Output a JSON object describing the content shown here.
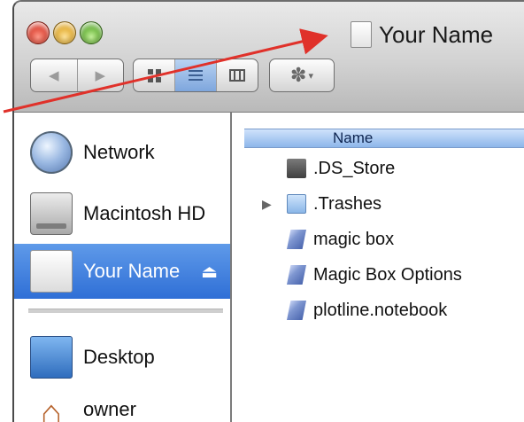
{
  "window": {
    "title": "Your Name"
  },
  "toolbar": {
    "back_glyph": "◀",
    "forward_glyph": "▶",
    "action_glyph": "✽",
    "action_caret": "▾"
  },
  "sidebar": {
    "items": [
      {
        "label": "Network",
        "icon": "network-globe-icon"
      },
      {
        "label": "Macintosh HD",
        "icon": "hard-drive-icon"
      },
      {
        "label": "Your Name",
        "icon": "disk-icon",
        "selected": true,
        "eject": "⏏"
      },
      {
        "label": "Desktop",
        "icon": "desktop-folder-icon"
      },
      {
        "label": "owner",
        "icon": "home-icon",
        "home_glyph": "⌂"
      }
    ]
  },
  "list": {
    "column_header": "Name",
    "rows": [
      {
        "name": ".DS_Store",
        "icon": "file-icon"
      },
      {
        "name": ".Trashes",
        "icon": "folder-icon",
        "disclosure": "▶"
      },
      {
        "name": "magic box",
        "icon": "app-icon"
      },
      {
        "name": "Magic Box Options",
        "icon": "app-icon"
      },
      {
        "name": "plotline.notebook",
        "icon": "app-icon"
      }
    ]
  },
  "colors": {
    "selection": "#2f6fd6",
    "header": "#8db6ea",
    "arrow": "#e0312a"
  }
}
